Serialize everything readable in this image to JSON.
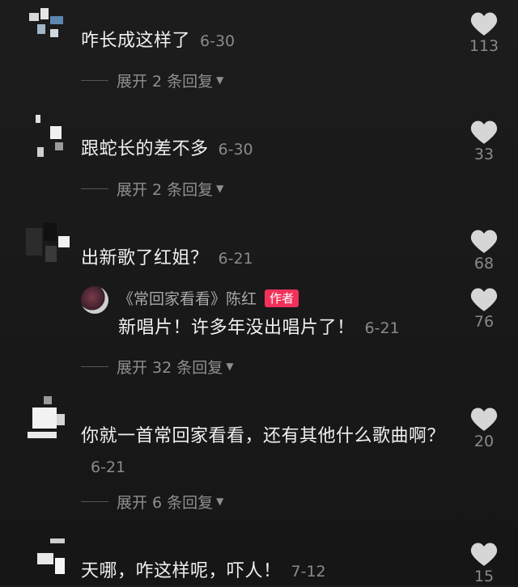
{
  "comments": [
    {
      "text": "咋长成这样了",
      "date": "6-30",
      "likes": "113",
      "expand": "展开 2 条回复"
    },
    {
      "text": "跟蛇长的差不多",
      "date": "6-30",
      "likes": "33",
      "expand": "展开 2 条回复"
    },
    {
      "text": "出新歌了红姐？",
      "date": "6-21",
      "likes": "68"
    },
    {
      "text": "你就一首常回家看看，还有其他什么歌曲啊？",
      "date": "6-21",
      "likes": "20",
      "expand": "展开 6 条回复"
    },
    {
      "text": "天哪，咋这样呢，吓人！",
      "date": "7-12",
      "likes": "15"
    }
  ],
  "reply": {
    "author": "《常回家看看》陈红",
    "badge": "作者",
    "text": "新唱片！许多年没出唱片了！",
    "date": "6-21",
    "likes": "76",
    "expand": "展开 32 条回复"
  },
  "colors": {
    "badge": "#f2315a",
    "background": "#1a1a1a",
    "secondary_text": "#8a8a8a"
  },
  "icons": {
    "like": "heart-icon",
    "expand": "triangle-down-icon"
  }
}
